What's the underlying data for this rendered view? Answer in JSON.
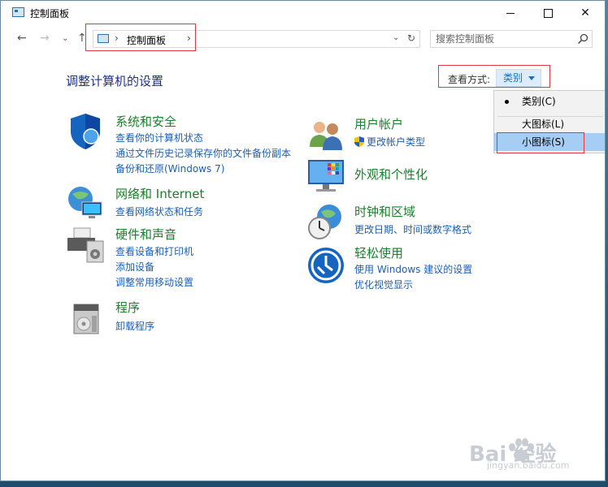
{
  "window": {
    "title": "控制面板"
  },
  "address": {
    "crumb": "控制面板",
    "search_placeholder": "搜索控制面板"
  },
  "header": {
    "title": "调整计算机的设置",
    "view_by_label": "查看方式:",
    "view_by_value": "类别"
  },
  "view_menu": {
    "items": [
      {
        "label": "类别(C)",
        "checked": true
      },
      {
        "label": "大图标(L)"
      },
      {
        "label": "小图标(S)",
        "highlighted": true
      }
    ]
  },
  "categories": {
    "system": {
      "title": "系统和安全",
      "links": [
        "查看你的计算机状态",
        "通过文件历史记录保存你的文件备份副本",
        "备份和还原(Windows 7)"
      ]
    },
    "network": {
      "title": "网络和 Internet",
      "links": [
        "查看网络状态和任务"
      ]
    },
    "hardware": {
      "title": "硬件和声音",
      "links": [
        "查看设备和打印机",
        "添加设备",
        "调整常用移动设置"
      ]
    },
    "programs": {
      "title": "程序",
      "links": [
        "卸载程序"
      ]
    },
    "users": {
      "title": "用户帐户",
      "links": [
        "更改帐户类型"
      ]
    },
    "appearance": {
      "title": "外观和个性化",
      "links": []
    },
    "clock": {
      "title": "时钟和区域",
      "links": [
        "更改日期、时间或数字格式"
      ]
    },
    "ease": {
      "title": "轻松使用",
      "links": [
        "使用 Windows 建议的设置",
        "优化视觉显示"
      ]
    }
  },
  "watermark": {
    "brand": "Bai  经验",
    "url": "jingyan.baidu.com"
  },
  "colors": {
    "title_blue": "#1e3287",
    "category_green": "#1a7f2a",
    "link_blue": "#1a5fb4",
    "highlight_red": "#e0383e",
    "menu_hover": "#a6cdf4"
  }
}
